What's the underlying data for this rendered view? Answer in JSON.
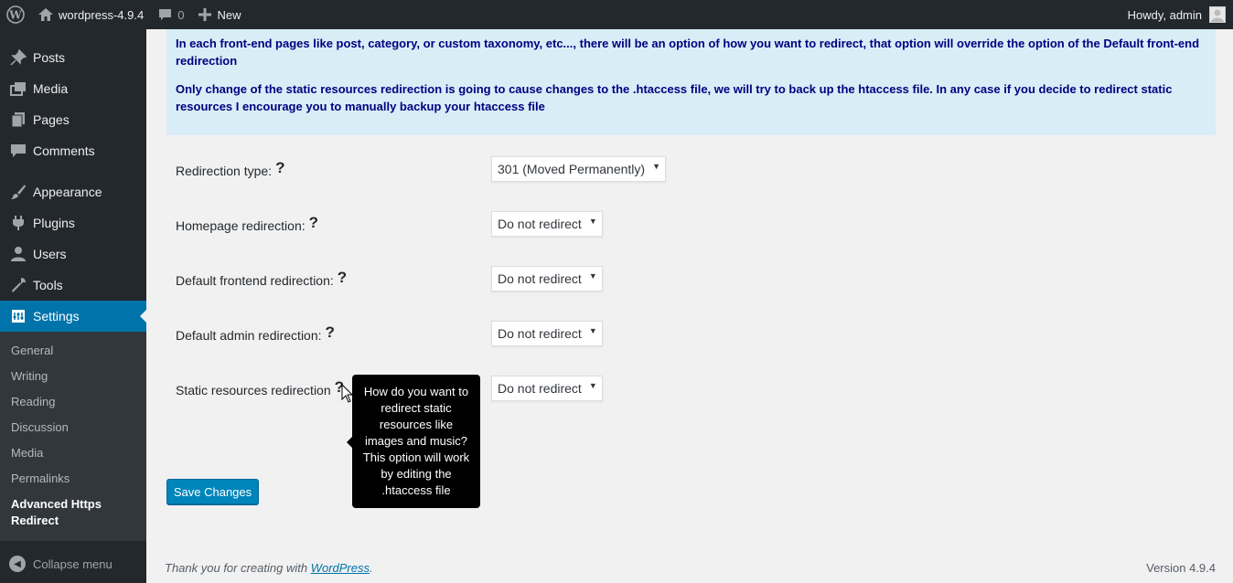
{
  "adminbar": {
    "site_name": "wordpress-4.9.4",
    "comments_count": "0",
    "new_label": "New",
    "greeting": "Howdy, admin"
  },
  "sidebar": {
    "items": [
      {
        "label": "Posts",
        "icon": "pin-icon"
      },
      {
        "label": "Media",
        "icon": "media-icon"
      },
      {
        "label": "Pages",
        "icon": "pages-icon"
      },
      {
        "label": "Comments",
        "icon": "comment-icon"
      },
      {
        "label": "Appearance",
        "icon": "brush-icon"
      },
      {
        "label": "Plugins",
        "icon": "plugin-icon"
      },
      {
        "label": "Users",
        "icon": "user-icon"
      },
      {
        "label": "Tools",
        "icon": "wrench-icon"
      },
      {
        "label": "Settings",
        "icon": "settings-icon"
      }
    ],
    "submenu": [
      "General",
      "Writing",
      "Reading",
      "Discussion",
      "Media",
      "Permalinks",
      "Advanced Https Redirect"
    ],
    "collapse_label": "Collapse menu"
  },
  "notice": {
    "p1": "In each front-end pages like post, category, or custom taxonomy, etc..., there will be an option of how you want to redirect, that option will override the option of the Default front-end redirection",
    "p2": "Only change of the static resources redirection is going to cause changes to the .htaccess file, we will try to back up the htaccess file. In any case if you decide to redirect static resources I encourage you to manually backup your htaccess file"
  },
  "form": {
    "help_glyph": "?",
    "rows": [
      {
        "label": "Redirection type:",
        "value": "301 (Moved Permanently)"
      },
      {
        "label": "Homepage redirection:",
        "value": "Do not redirect"
      },
      {
        "label": "Default frontend redirection:",
        "value": "Do not redirect"
      },
      {
        "label": "Default admin redirection:",
        "value": "Do not redirect"
      },
      {
        "label": "Static resources redirection",
        "value": "Do not redirect"
      }
    ]
  },
  "tooltip": {
    "text": "How do you want to redirect static resources like images and music? This option will work by editing the .htaccess file"
  },
  "save_label": "Save Changes",
  "footer": {
    "thanks_prefix": "Thank you for creating with",
    "wp_link": "WordPress",
    "thanks_suffix": ".",
    "version": "Version 4.9.4"
  },
  "colors": {
    "admin_bg": "#23282d",
    "accent": "#0073aa",
    "notice_bg": "#d9edf7",
    "notice_text": "#000080",
    "button": "#0085ba"
  }
}
